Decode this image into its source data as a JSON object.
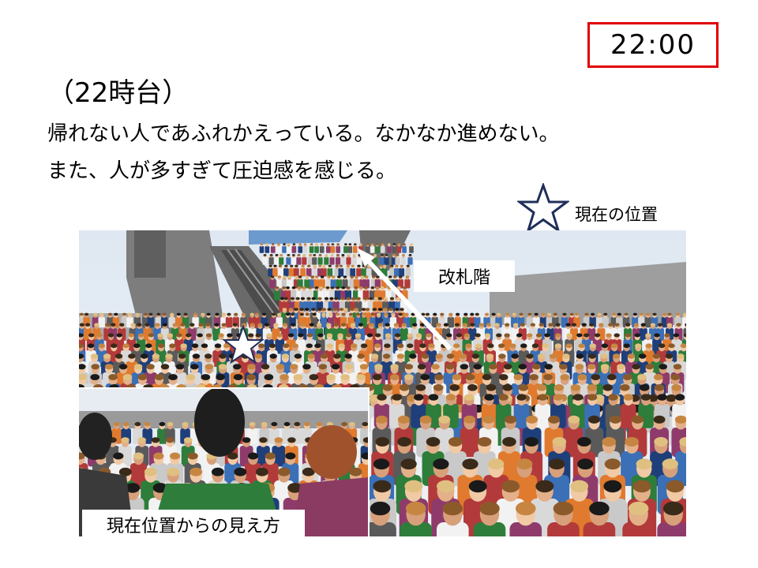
{
  "time": "22:00",
  "heading": "（22時台）",
  "lines": [
    "帰れない人であふれかえっている。なかなか進めない。",
    "また、人が多すぎて圧迫感を感じる。"
  ],
  "legend": {
    "icon": "star-outline-icon",
    "label": "現在の位置"
  },
  "scene": {
    "gate_label": "改札階",
    "view_label": "現在位置からの見え方"
  },
  "colors": {
    "time_border": "#e00000",
    "star_stroke": "#1f2f5a"
  }
}
